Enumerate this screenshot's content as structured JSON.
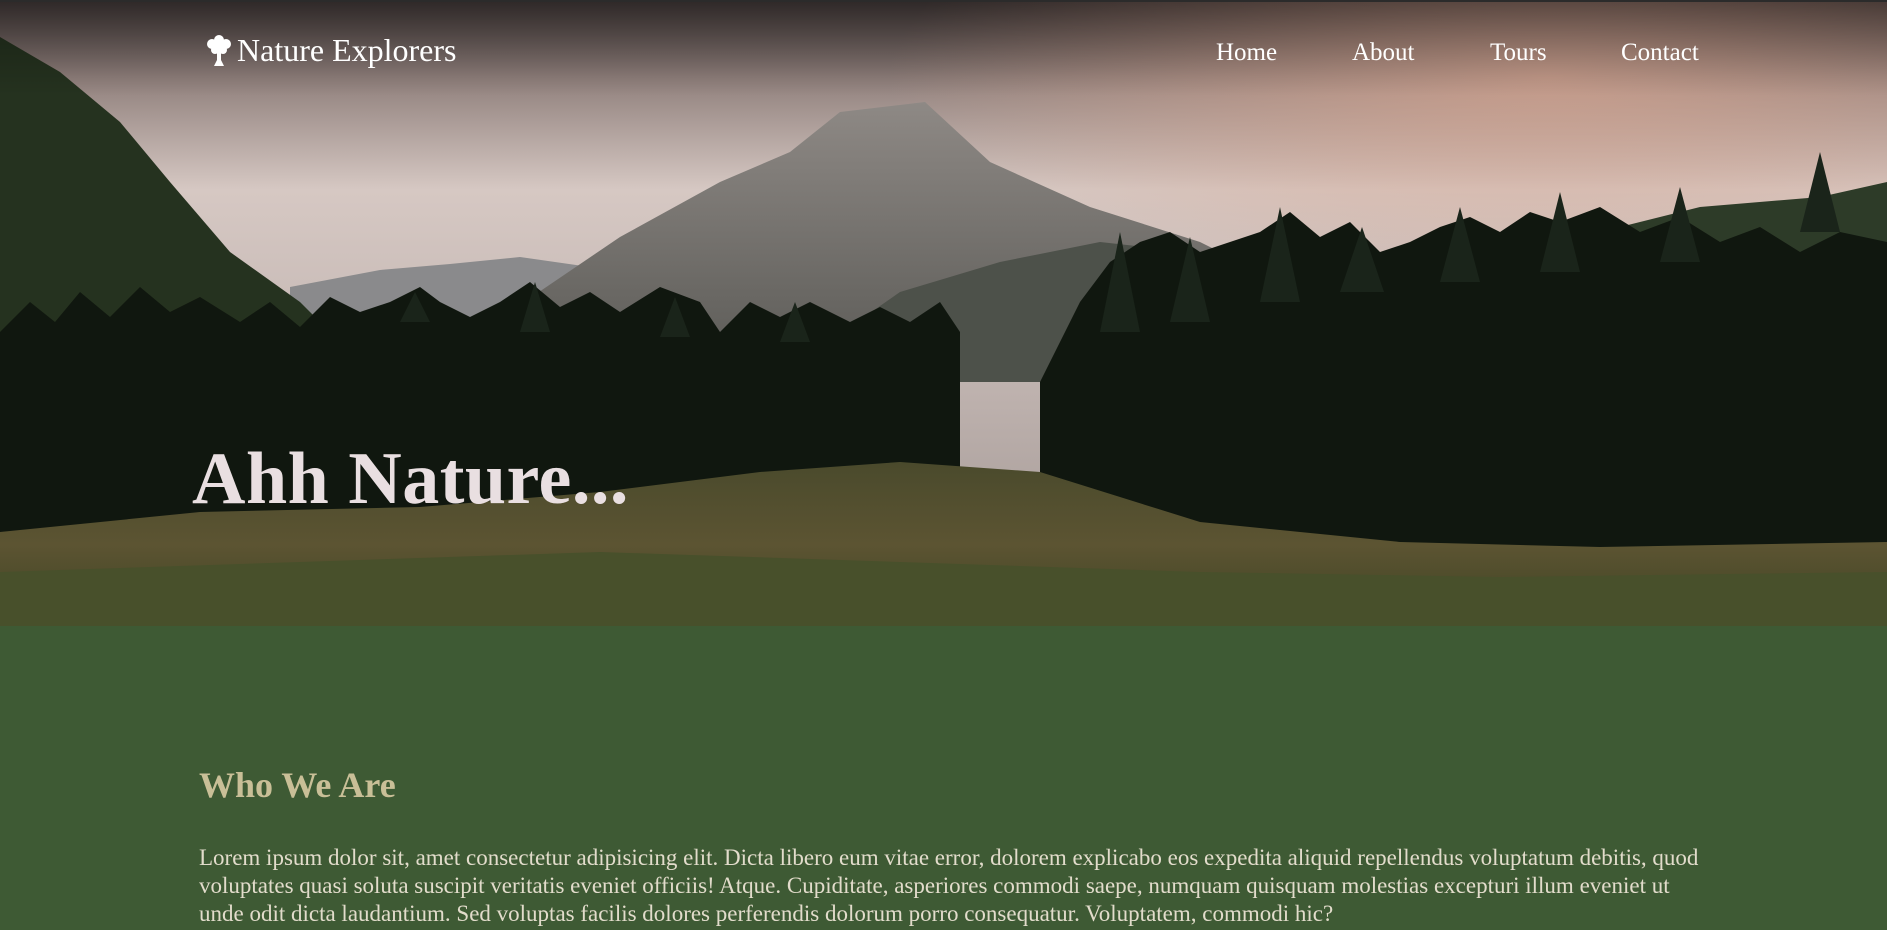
{
  "header": {
    "brand_name": "Nature Explorers",
    "logo_icon": "tree-icon",
    "nav_items": [
      {
        "label": "Home"
      },
      {
        "label": "About"
      },
      {
        "label": "Tours"
      },
      {
        "label": "Contact"
      }
    ]
  },
  "hero": {
    "headline": "Ahh Nature...",
    "background": "mountain-forest-photo"
  },
  "about": {
    "heading": "Who We Are",
    "body": "Lorem ipsum dolor sit, amet consectetur adipisicing elit. Dicta libero eum vitae error, dolorem explicabo eos expedita aliquid repellendus voluptatum debitis, quod voluptates quasi soluta suscipit veritatis eveniet officiis! Atque. Cupiditate, asperiores commodi saepe, numquam quisquam molestias excepturi illum eveniet ut unde odit dicta laudantium. Sed voluptas facilis dolores perferendis dolorum porro consequatur. Voluptatem, commodi hic?"
  },
  "colors": {
    "section_bg": "#3e5a34",
    "heading_color": "#c9bf97",
    "body_text": "#e2dccb",
    "headline_text": "#e9dfe1",
    "nav_text": "#ffffff"
  }
}
